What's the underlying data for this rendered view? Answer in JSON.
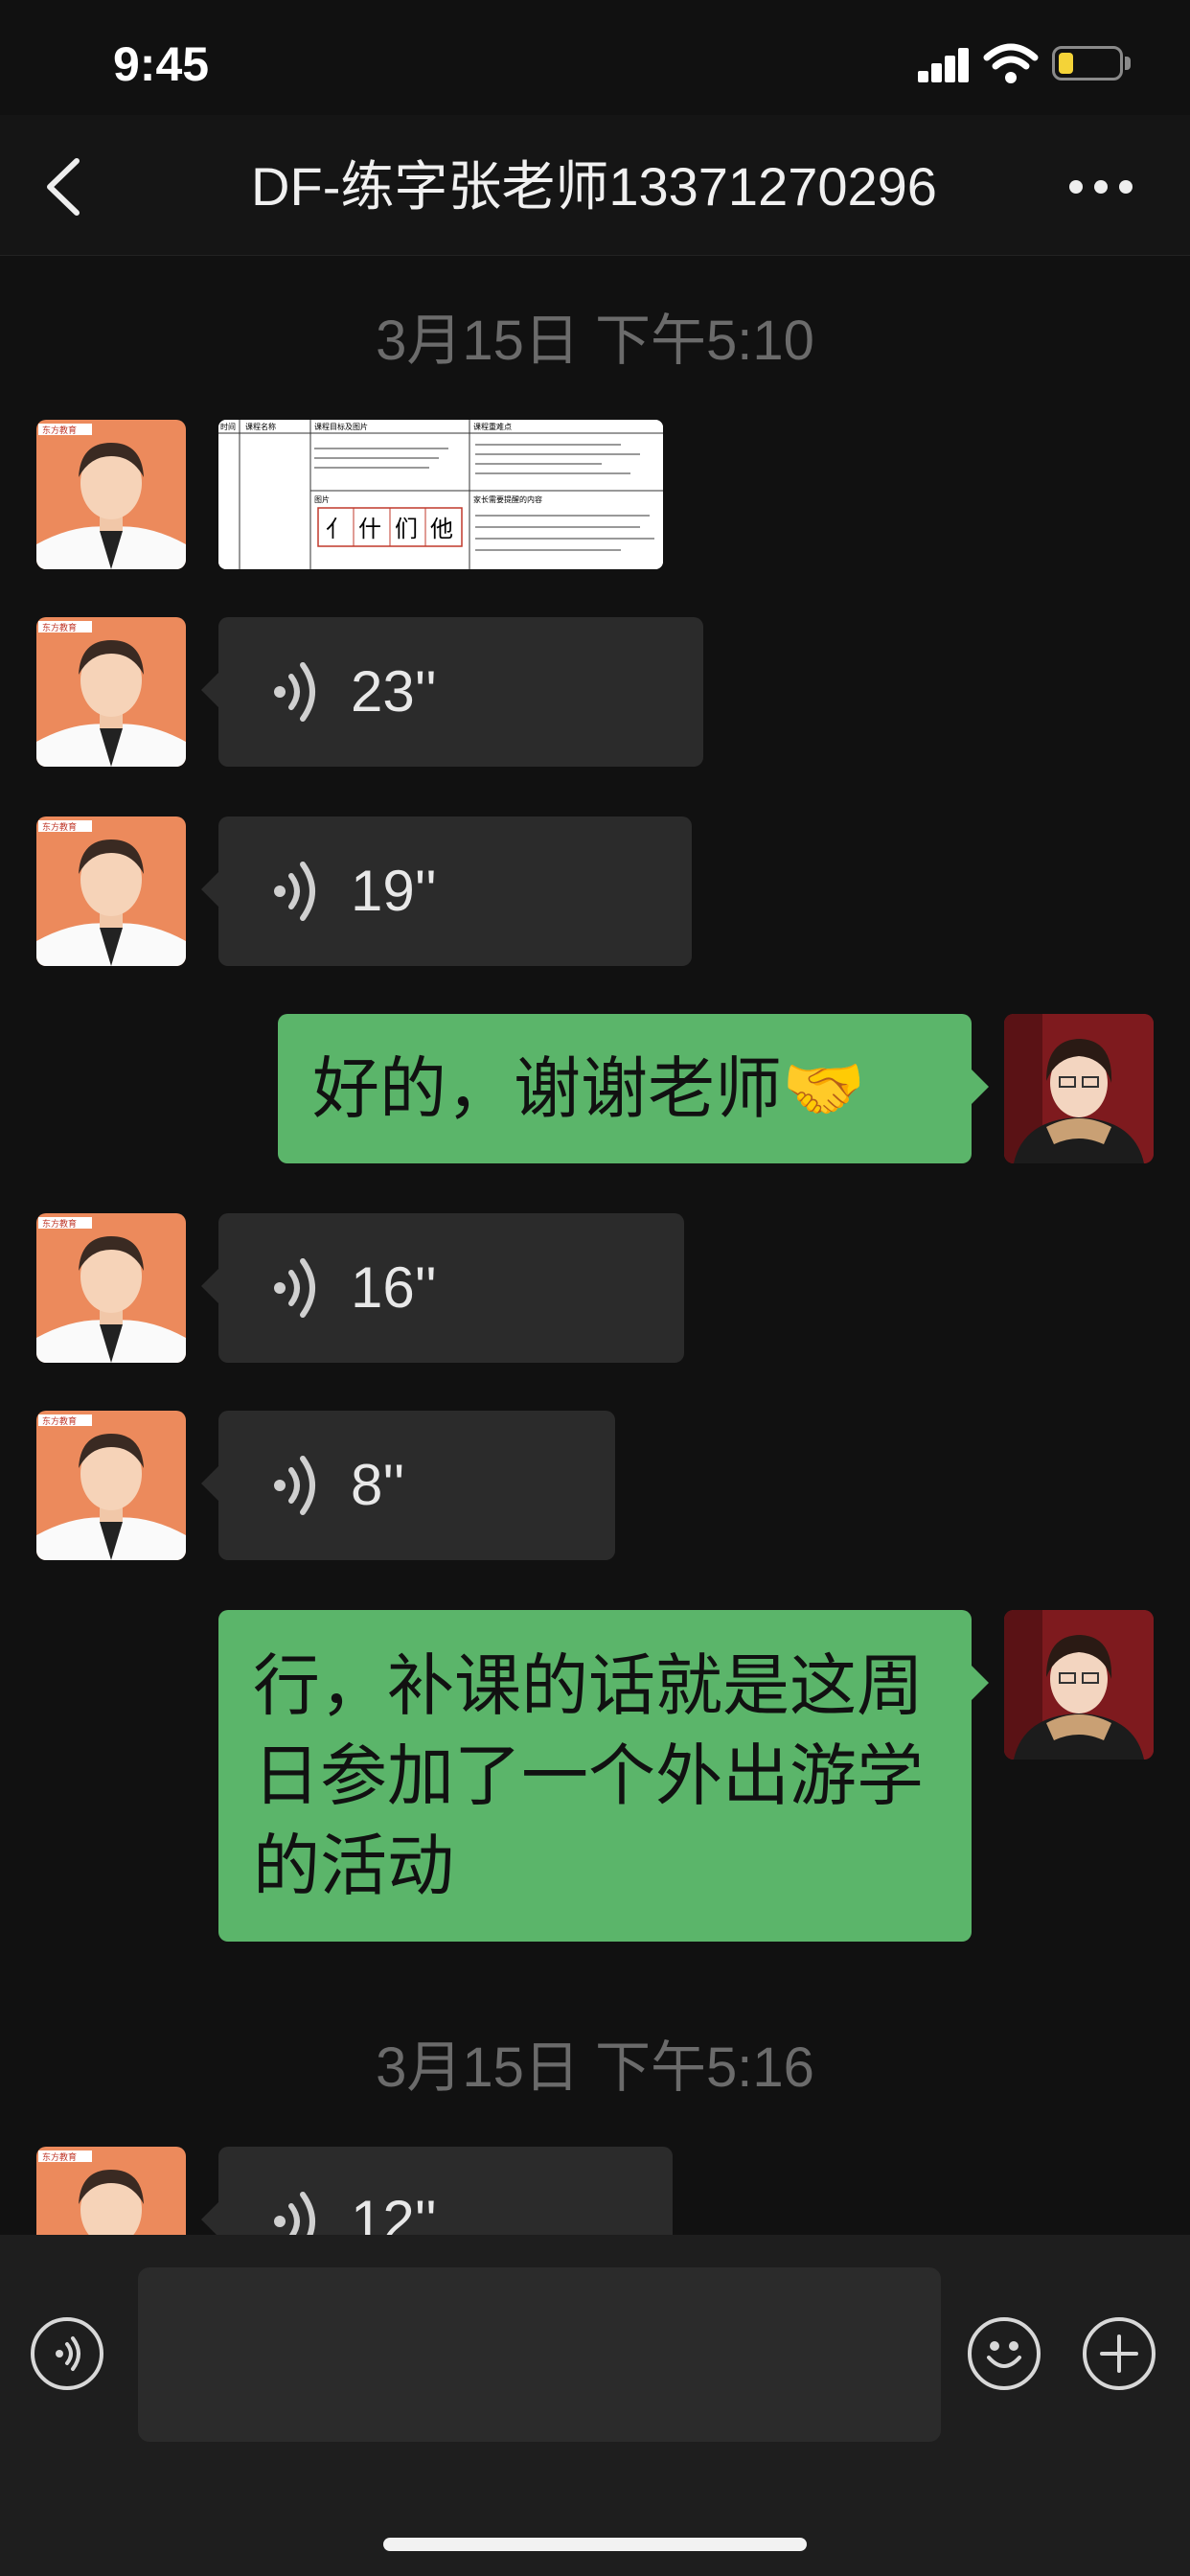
{
  "status_bar": {
    "time": "9:45",
    "battery_level": 0.25
  },
  "nav": {
    "title": "DF-练字张老师13371270296"
  },
  "messages": {
    "stamp1": "3月15日 下午5:10",
    "voice1": "23''",
    "voice2": "19''",
    "text1": "好的，谢谢老师🤝",
    "voice3": "16''",
    "voice4": "8''",
    "text2": "行，补课的话就是这周日参加了一个外出游学的活动",
    "stamp2": "3月15日 下午5:16",
    "voice5": "12''"
  },
  "image_card": {
    "headers": [
      "时间",
      "课程名称",
      "课程目标及图片",
      "课程重难点"
    ],
    "chars": [
      "亻",
      "什",
      "们",
      "他"
    ],
    "label_pic": "图片",
    "label_parent": "家长需要提醒的内容"
  },
  "avatar_text": {
    "brand": "东方教育"
  },
  "colors": {
    "bubble_green": "#5bb56a",
    "bubble_dark": "#2b2b2b",
    "background": "#111111"
  }
}
